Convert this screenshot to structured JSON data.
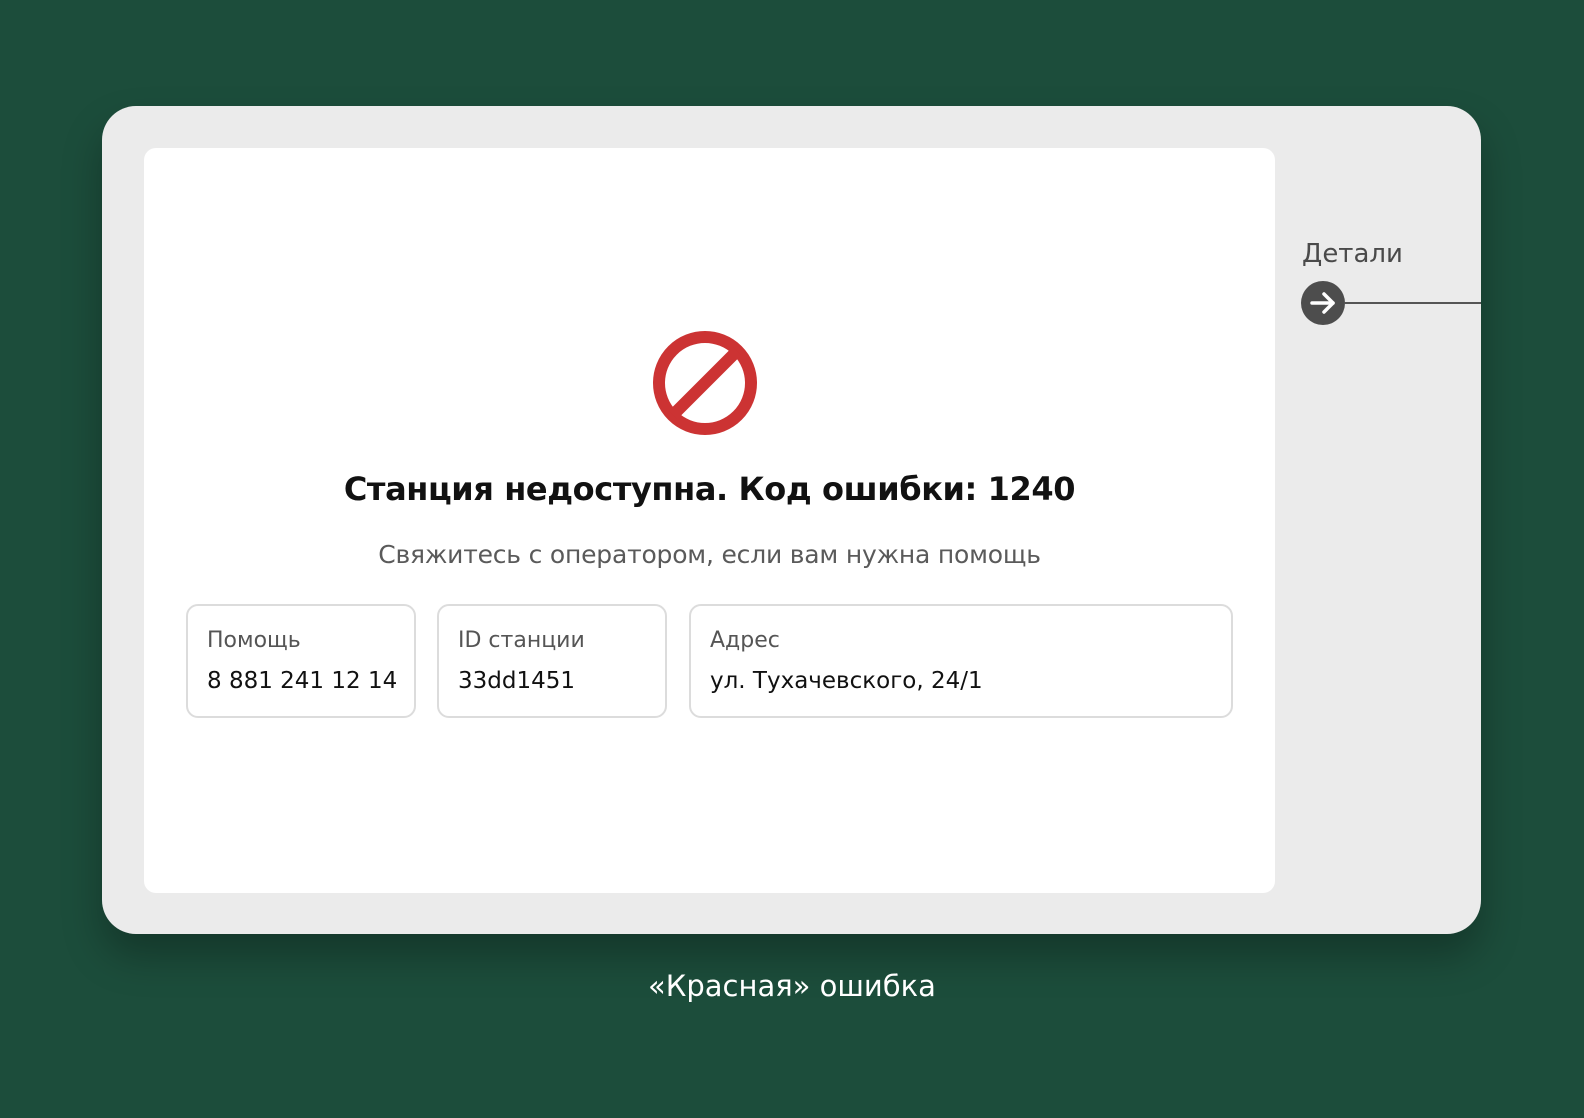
{
  "error": {
    "title": "Станция недоступна. Код ошибки: 1240",
    "subtitle": "Свяжитесь с оператором, если вам нужна помощь",
    "icon": "prohibited-icon",
    "icon_color": "#cc3333"
  },
  "cards": {
    "help": {
      "label": "Помощь",
      "value": "8 881 241 12 14"
    },
    "station_id": {
      "label": "ID станции",
      "value": "33dd1451"
    },
    "address": {
      "label": "Адрес",
      "value": "ул. Тухачевского, 24/1"
    }
  },
  "details": {
    "label": "Детали",
    "icon": "arrow-right-circle-icon"
  },
  "caption": "«Красная» ошибка",
  "colors": {
    "background": "#1c4d3b",
    "device": "#ebebeb",
    "panel": "#ffffff",
    "error": "#cc3333"
  }
}
